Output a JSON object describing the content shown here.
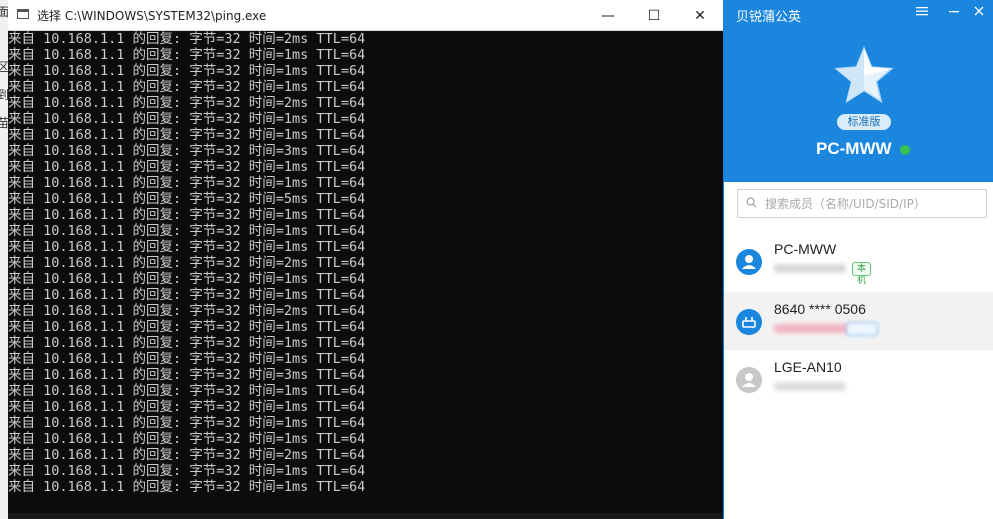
{
  "background_app": {
    "glyphs": [
      "面",
      "区",
      "到",
      "苗"
    ]
  },
  "console": {
    "title": "选择 C:\\WINDOWS\\SYSTEM32\\ping.exe",
    "lines": [
      "来自 10.168.1.1 的回复: 字节=32 时间=2ms TTL=64",
      "来自 10.168.1.1 的回复: 字节=32 时间=1ms TTL=64",
      "来自 10.168.1.1 的回复: 字节=32 时间=1ms TTL=64",
      "来自 10.168.1.1 的回复: 字节=32 时间=1ms TTL=64",
      "来自 10.168.1.1 的回复: 字节=32 时间=2ms TTL=64",
      "来自 10.168.1.1 的回复: 字节=32 时间=1ms TTL=64",
      "来自 10.168.1.1 的回复: 字节=32 时间=1ms TTL=64",
      "来自 10.168.1.1 的回复: 字节=32 时间=3ms TTL=64",
      "来自 10.168.1.1 的回复: 字节=32 时间=1ms TTL=64",
      "来自 10.168.1.1 的回复: 字节=32 时间=1ms TTL=64",
      "来自 10.168.1.1 的回复: 字节=32 时间=5ms TTL=64",
      "来自 10.168.1.1 的回复: 字节=32 时间=1ms TTL=64",
      "来自 10.168.1.1 的回复: 字节=32 时间=1ms TTL=64",
      "来自 10.168.1.1 的回复: 字节=32 时间=1ms TTL=64",
      "来自 10.168.1.1 的回复: 字节=32 时间=2ms TTL=64",
      "来自 10.168.1.1 的回复: 字节=32 时间=1ms TTL=64",
      "来自 10.168.1.1 的回复: 字节=32 时间=1ms TTL=64",
      "来自 10.168.1.1 的回复: 字节=32 时间=2ms TTL=64",
      "来自 10.168.1.1 的回复: 字节=32 时间=1ms TTL=64",
      "来自 10.168.1.1 的回复: 字节=32 时间=1ms TTL=64",
      "来自 10.168.1.1 的回复: 字节=32 时间=1ms TTL=64",
      "来自 10.168.1.1 的回复: 字节=32 时间=3ms TTL=64",
      "来自 10.168.1.1 的回复: 字节=32 时间=1ms TTL=64",
      "来自 10.168.1.1 的回复: 字节=32 时间=1ms TTL=64",
      "来自 10.168.1.1 的回复: 字节=32 时间=1ms TTL=64",
      "来自 10.168.1.1 的回复: 字节=32 时间=1ms TTL=64",
      "来自 10.168.1.1 的回复: 字节=32 时间=2ms TTL=64",
      "来自 10.168.1.1 的回复: 字节=32 时间=1ms TTL=64",
      "来自 10.168.1.1 的回复: 字节=32 时间=1ms TTL=64"
    ],
    "buttons": {
      "minimize": "—",
      "maximize": "☐",
      "close": "✕"
    }
  },
  "panel": {
    "app_title": "贝锐蒲公英",
    "menu_icon": "hamburger-icon",
    "minimize_icon": "minimize-icon",
    "close_icon": "close-icon",
    "edition_badge": "标准版",
    "device_name": "PC-MWW",
    "device_status_color": "#36c24c",
    "brand_color": "#1a86de",
    "search": {
      "placeholder": "搜索成员（名称/UID/SID/IP）",
      "value": ""
    },
    "members": [
      {
        "name": "PC-MWW",
        "tag": "本机",
        "tag_color": "green",
        "avatar": "user-avatar-icon",
        "avatar_color": "#1a86de",
        "blur_color": "#d8d8d8"
      },
      {
        "name": "8640 **** 0506",
        "tag": "",
        "tag_color": "blue",
        "avatar": "router-avatar-icon",
        "avatar_color": "#1a86de",
        "blur_color": "#f1b5c4"
      },
      {
        "name": "LGE-AN10",
        "tag": "",
        "tag_color": "",
        "avatar": "user-avatar-icon",
        "avatar_color": "#c8c8c8",
        "blur_color": "#dddddd"
      }
    ]
  }
}
